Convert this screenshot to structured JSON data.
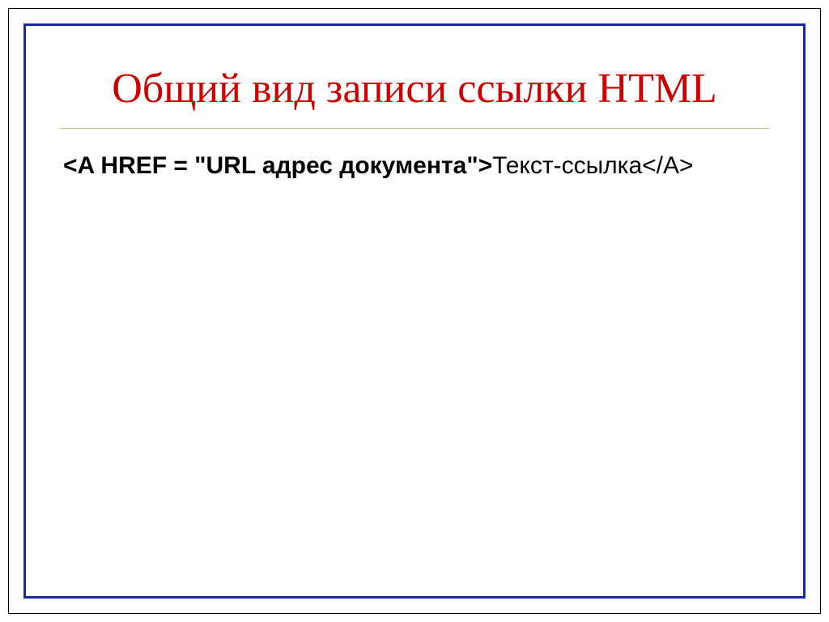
{
  "slide": {
    "title": "Общий вид записи ссылки HTML",
    "code_bold": "<A HREF = \"URL адрес документа\">",
    "code_rest": "Текст-ссылка</A>"
  }
}
